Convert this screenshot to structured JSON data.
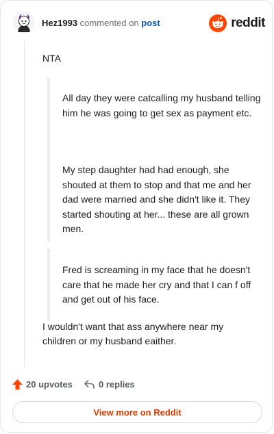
{
  "header": {
    "username": "Hez1993",
    "action": "commented on",
    "link": "post",
    "brand": "reddit"
  },
  "comment": {
    "intro": "NTA",
    "quotes": [
      "All day they were catcalling my husband telling him he was going to get sex as payment etc.",
      "My step daughter had had enough, she shouted at them to stop and that me and her dad were married and she didn't like it. They started shouting at her... these are all grown men.",
      "Fred is screaming in my face that he doesn't care that he made her cry and that I can f off and get out of his face."
    ],
    "outro": "I wouldn't want that ass anywhere near my children or my husband eaither."
  },
  "footer": {
    "upvotes": "20 upvotes",
    "replies": "0 replies",
    "view_more": "View more on Reddit"
  },
  "colors": {
    "accent": "#ff4500",
    "link": "#0a58b3",
    "view_more": "#d93a00"
  },
  "icons": [
    "avatar-icon",
    "reddit-logo-icon",
    "upvote-arrow-icon",
    "reply-arrow-icon"
  ]
}
